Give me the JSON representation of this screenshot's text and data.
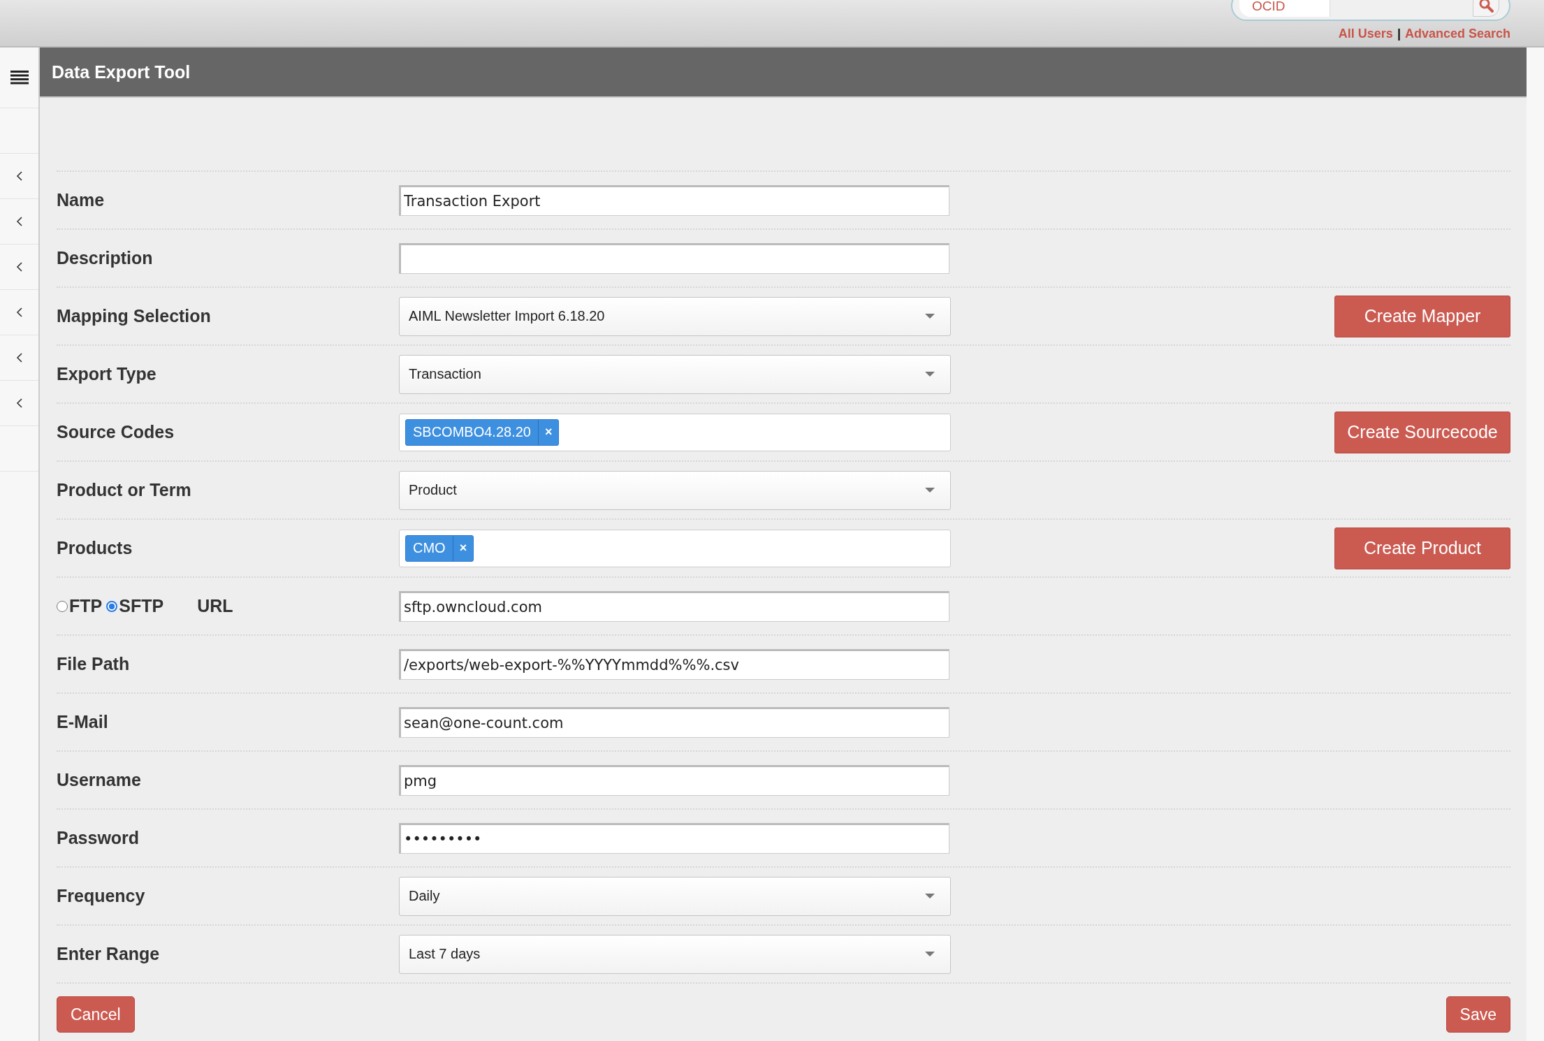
{
  "top_bar": {
    "search": {
      "category": "OCID"
    },
    "links": [
      {
        "label": "All Users"
      },
      {
        "label": "Advanced Search"
      }
    ],
    "separator": "|"
  },
  "sidebar": {
    "rows": [
      {
        "kind": "blank"
      },
      {
        "kind": "chevron"
      },
      {
        "kind": "chevron"
      },
      {
        "kind": "chevron"
      },
      {
        "kind": "chevron"
      },
      {
        "kind": "chevron"
      },
      {
        "kind": "chevron"
      },
      {
        "kind": "blank"
      }
    ]
  },
  "header": {
    "title": "Data Export Tool"
  },
  "fields": [
    {
      "kind": "text",
      "label": "Name",
      "value": "Transaction Export"
    },
    {
      "kind": "text",
      "label": "Description"
    },
    {
      "kind": "select",
      "label": "Mapping Selection",
      "value": "AIML Newsletter Import 6.18.20",
      "action": "Create Mapper"
    },
    {
      "kind": "select",
      "label": "Export Type",
      "value": "Transaction"
    },
    {
      "kind": "tags",
      "label": "Source Codes",
      "tags": [
        {
          "label": "SBCOMBO4.28.20",
          "remove": "×"
        }
      ],
      "action": "Create Sourcecode"
    },
    {
      "kind": "select",
      "label": "Product or Term",
      "value": "Product"
    },
    {
      "kind": "tags",
      "label": "Products",
      "tags": [
        {
          "label": "CMO",
          "remove": "×"
        }
      ],
      "action": "Create Product"
    },
    {
      "kind": "protocol",
      "label": "URL",
      "options": [
        {
          "label": "FTP",
          "selected": false
        },
        {
          "label": "SFTP",
          "selected": true
        }
      ],
      "value": "sftp.owncloud.com"
    },
    {
      "kind": "text",
      "label": "File Path",
      "value": "/exports/web-export-%%YYYYmmdd%%%.csv"
    },
    {
      "kind": "text",
      "label": "E-Mail",
      "value": "sean@one-count.com"
    },
    {
      "kind": "text",
      "label": "Username",
      "value": "pmg"
    },
    {
      "kind": "text",
      "label": "Password",
      "value": "•••••••••"
    },
    {
      "kind": "select",
      "label": "Frequency",
      "value": "Daily"
    },
    {
      "kind": "select",
      "label": "Enter Range",
      "value": "Last 7 days"
    }
  ],
  "buttons": {
    "cancel": "Cancel",
    "save": "Save"
  }
}
